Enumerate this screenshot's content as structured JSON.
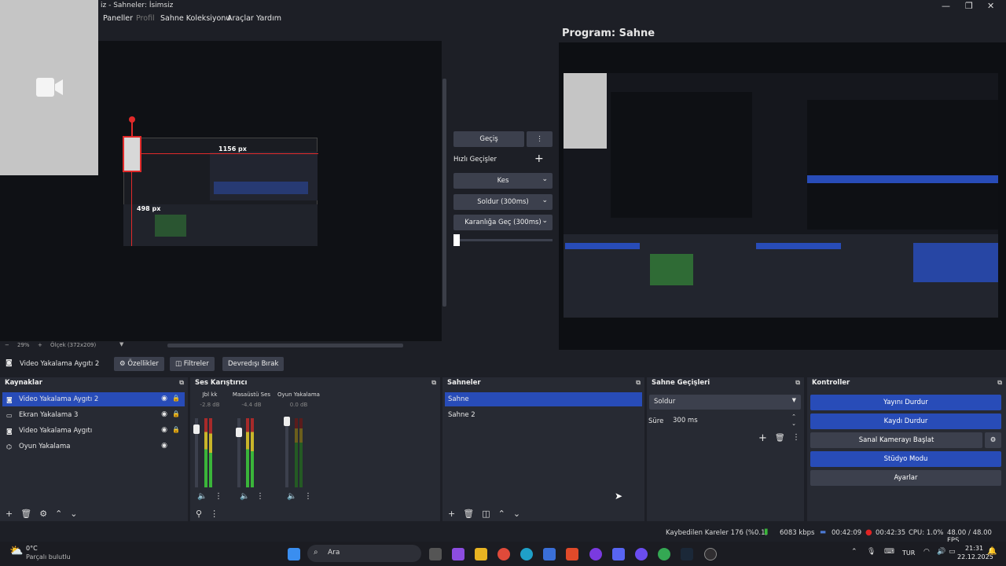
{
  "window": {
    "title": "iz - Sahneler: İsimsiz",
    "minimize": "—",
    "maximize": "❐",
    "close": "✕"
  },
  "menu": {
    "items": [
      "Paneller",
      "Profil",
      "Sahne Koleksiyonu",
      "Araçlar",
      "Yardım"
    ]
  },
  "preview": {
    "scale_left": "29%",
    "scale_label": "Ölçek (372x209)",
    "measure_w": "1156 px",
    "measure_h": "498 px"
  },
  "transitions_mid": {
    "transition_button": "Geçiş",
    "quick_label": "Hızlı Geçişler",
    "items": [
      "Kes",
      "Soldur (300ms)",
      "Karanlığa Geç (300ms)"
    ],
    "slider_position": 0
  },
  "program": {
    "title": "Program: Sahne"
  },
  "source_toolbar": {
    "selected": "Video Yakalama Aygıtı 2",
    "properties": "Özellikler",
    "filters": "Filtreler",
    "deactivate": "Devredışı Bırak"
  },
  "sources": {
    "title": "Kaynaklar",
    "items": [
      {
        "label": "Video Yakalama Aygıtı 2",
        "icon": "camera-icon"
      },
      {
        "label": "Ekran Yakalama 3",
        "icon": "monitor-icon"
      },
      {
        "label": "Video Yakalama Aygıtı",
        "icon": "camera-icon"
      },
      {
        "label": "Oyun Yakalama",
        "icon": "gamepad-icon"
      }
    ]
  },
  "mixer": {
    "title": "Ses Karıştırıcı",
    "channels": [
      {
        "name": "Jbl kk",
        "db": "-2.8 dB"
      },
      {
        "name": "Masaüstü Ses",
        "db": "-4.4 dB"
      },
      {
        "name": "Oyun Yakalama",
        "db": "0.0 dB"
      }
    ],
    "scale": [
      "0",
      "-5",
      "-10",
      "-15",
      "-20",
      "-25",
      "-30",
      "-35",
      "-40",
      "-45",
      "-50",
      "-55",
      "-60"
    ]
  },
  "scenes": {
    "title": "Sahneler",
    "items": [
      "Sahne",
      "Sahne 2"
    ]
  },
  "scene_transitions": {
    "title": "Sahne Geçişleri",
    "selected": "Soldur",
    "duration_label": "Süre",
    "duration": "300 ms"
  },
  "controls": {
    "title": "Kontroller",
    "stop_stream": "Yayını Durdur",
    "stop_record": "Kaydı Durdur",
    "virtual_cam": "Sanal Kamerayı Başlat",
    "studio_mode": "Stüdyo Modu",
    "settings": "Ayarlar"
  },
  "status": {
    "dropped": "Kaybedilen Kareler 176 (%0.1)",
    "bitrate": "6083 kbps",
    "stream_time": "00:42:09",
    "rec_time": "00:42:35",
    "cpu": "CPU: 1.0%",
    "fps": "48.00 / 48.00 FPS"
  },
  "taskbar": {
    "weather_temp": "0°C",
    "weather_desc": "Parçalı bulutlu",
    "search": "Ara",
    "lang": "TUR",
    "time": "21:31",
    "date": "22.12.2025"
  },
  "colors": {
    "accent": "#284cb8",
    "panel": "#272a33",
    "bg": "#1d1f26",
    "record": "#e02424",
    "webcam": "#c5c5c5"
  }
}
